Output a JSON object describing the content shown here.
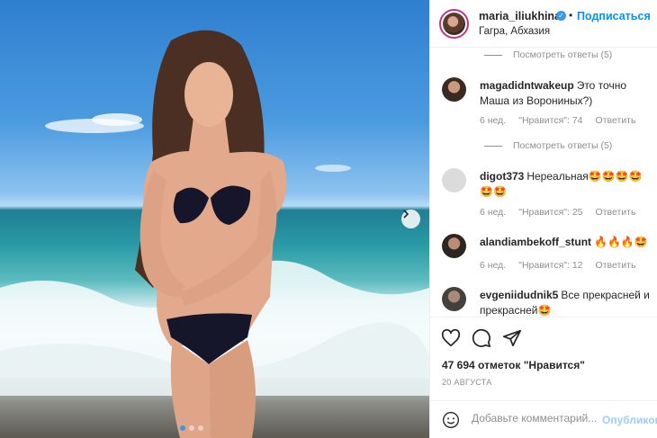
{
  "post": {
    "photo_alt": "",
    "carousel_total": 3,
    "carousel_active": 1
  },
  "header": {
    "username": "maria_iliukhina",
    "separator": "•",
    "follow_label": "Подписаться",
    "location": "Гагра, Абхазия"
  },
  "comments": {
    "view_replies_1": "Посмотреть ответы (5)",
    "view_replies_2": "Посмотреть ответы (5)",
    "items": [
      {
        "user": "magadidntwakeup",
        "text": "Это точно Маша из Ворониных?)",
        "age": "6 нед.",
        "likes": "\"Нравится\": 74",
        "reply": "Ответить"
      },
      {
        "user": "digot373",
        "text": "Нереальная🤩🤩🤩🤩🤩🤩",
        "age": "6 нед.",
        "likes": "\"Нравится\": 25",
        "reply": "Ответить"
      },
      {
        "user": "alandiambekoff_stunt",
        "text": "🔥🔥🔥🤩",
        "age": "6 нед.",
        "likes": "\"Нравится\": 12",
        "reply": "Ответить"
      },
      {
        "user": "evgeniidudnik5",
        "text": "Все прекрасней и прекрасней🤩",
        "age": "",
        "likes": "",
        "reply": ""
      }
    ]
  },
  "actions": {
    "likes_text": "47 694 отметок \"Нравится\"",
    "date_text": "20 АВГУСТА"
  },
  "add_comment": {
    "placeholder": "Добавьте комментарий...",
    "publish_label": "Опубликовать"
  },
  "colors": {
    "accent": "#0095f6",
    "muted": "#8e8e8e",
    "verified": "#3897f0"
  }
}
